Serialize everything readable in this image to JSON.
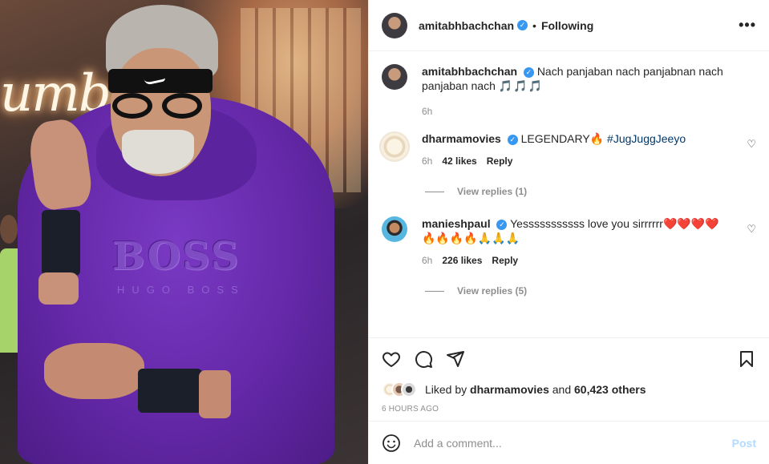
{
  "post": {
    "author": "amitabhbachchan",
    "follow_status": "Following",
    "separator": "•",
    "more_label": "•••",
    "photo_texts": {
      "neon": "umba",
      "logo": "BOSS",
      "sublogo": "HUGO BOSS"
    }
  },
  "caption": {
    "author": "amitabhbachchan",
    "text": "Nach panjaban nach panjabnan nach panjaban nach",
    "emoji": "🎵🎵🎵",
    "time": "6h"
  },
  "comments": [
    {
      "author": "dharmamovies",
      "text": "LEGENDARY🔥",
      "hashtag": "#JugJuggJeeyo",
      "time": "6h",
      "likes": "42 likes",
      "reply_label": "Reply",
      "view_replies": "View replies (1)"
    },
    {
      "author": "manieshpaul",
      "text": "Yesssssssssss love you sirrrrrr❤️❤️❤️❤️🔥🔥🔥🔥🙏🙏🙏",
      "time": "6h",
      "likes": "226 likes",
      "reply_label": "Reply",
      "view_replies": "View replies (5)"
    }
  ],
  "likes_summary": {
    "prefix": "Liked by",
    "user": "dharmamovies",
    "middle": "and",
    "others": "60,423 others"
  },
  "timestamp": "6 HOURS AGO",
  "comment_box": {
    "placeholder": "Add a comment...",
    "post_label": "Post"
  },
  "colors": {
    "verified": "#3897f0",
    "post_button": "#b3dbff",
    "hoodie": "#6a2bb0"
  },
  "icons": [
    "heart-icon",
    "comment-icon",
    "share-icon",
    "bookmark-icon",
    "emoji-icon",
    "more-icon",
    "verified-badge"
  ]
}
